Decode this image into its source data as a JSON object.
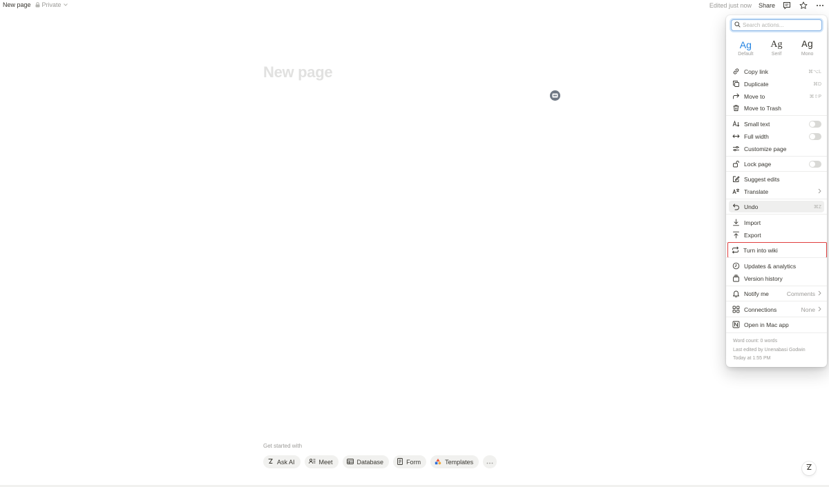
{
  "topbar": {
    "page_title": "New page",
    "privacy": "Private",
    "edited": "Edited just now",
    "share": "Share"
  },
  "page": {
    "title_placeholder": "New page"
  },
  "menu": {
    "search_placeholder": "Search actions...",
    "fonts": [
      {
        "sample": "Ag",
        "name": "Default",
        "selected": true
      },
      {
        "sample": "Ag",
        "name": "Serif",
        "selected": false
      },
      {
        "sample": "Ag",
        "name": "Mono",
        "selected": false
      }
    ],
    "items": {
      "copy_link": {
        "label": "Copy link",
        "shortcut": "⌘⌥L"
      },
      "duplicate": {
        "label": "Duplicate",
        "shortcut": "⌘D"
      },
      "move_to": {
        "label": "Move to",
        "shortcut": "⌘⇧P"
      },
      "move_to_trash": {
        "label": "Move to Trash"
      },
      "small_text": {
        "label": "Small text"
      },
      "full_width": {
        "label": "Full width"
      },
      "customize_page": {
        "label": "Customize page"
      },
      "lock_page": {
        "label": "Lock page"
      },
      "suggest_edits": {
        "label": "Suggest edits"
      },
      "translate": {
        "label": "Translate"
      },
      "undo": {
        "label": "Undo",
        "shortcut": "⌘Z"
      },
      "import": {
        "label": "Import"
      },
      "export": {
        "label": "Export"
      },
      "turn_into_wiki": {
        "label": "Turn into wiki"
      },
      "updates_analytics": {
        "label": "Updates & analytics"
      },
      "version_history": {
        "label": "Version history"
      },
      "notify_me": {
        "label": "Notify me",
        "value": "Comments"
      },
      "connections": {
        "label": "Connections",
        "value": "None"
      },
      "open_in_mac_app": {
        "label": "Open in Mac app"
      }
    },
    "footer": {
      "word_count": "Word count: 0 words",
      "last_edited_by": "Last edited by Unenabasi Godwin",
      "edited_time": "Today at 1:55 PM"
    }
  },
  "get_started": {
    "label": "Get started with",
    "chips": [
      {
        "label": "Ask AI"
      },
      {
        "label": "Meet"
      },
      {
        "label": "Database"
      },
      {
        "label": "Form"
      },
      {
        "label": "Templates"
      }
    ]
  },
  "colors": {
    "accent": "#2383e2",
    "highlight_outline": "#e03e3e",
    "text": "#37352f",
    "muted": "#9b9a97"
  }
}
